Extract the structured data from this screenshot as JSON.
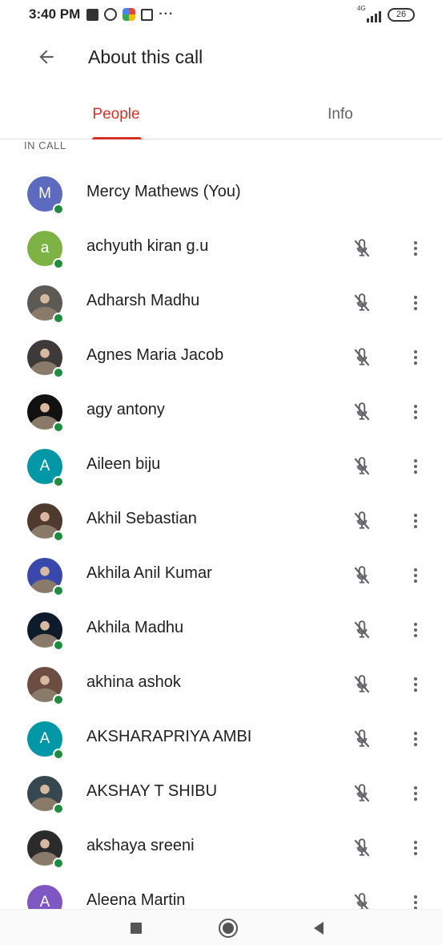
{
  "status_bar": {
    "time": "3:40 PM",
    "network": "4G",
    "battery": "26",
    "overflow": "···"
  },
  "header": {
    "title": "About this call",
    "back_icon": "arrow-back-icon"
  },
  "tabs": [
    {
      "label": "People",
      "active": true
    },
    {
      "label": "Info",
      "active": false
    }
  ],
  "section": {
    "label": "IN CALL"
  },
  "colors": {
    "accent": "#d93025",
    "presence": "#1e8e3e",
    "muted_icon": "#5f6368"
  },
  "people": [
    {
      "name": "Mercy Mathews (You)",
      "avatar_type": "letter",
      "initial": "M",
      "avatar_color": "#5c6bc0",
      "muted": false,
      "menu": false
    },
    {
      "name": "achyuth kiran g.u",
      "avatar_type": "letter",
      "initial": "a",
      "avatar_color": "#7cb342",
      "muted": true,
      "menu": true
    },
    {
      "name": "Adharsh Madhu",
      "avatar_type": "photo",
      "avatar_color": "#5d5a55",
      "muted": true,
      "menu": true
    },
    {
      "name": "Agnes Maria Jacob",
      "avatar_type": "photo",
      "avatar_color": "#3e3a3a",
      "muted": true,
      "menu": true
    },
    {
      "name": "agy antony",
      "avatar_type": "photo",
      "avatar_color": "#111111",
      "muted": true,
      "menu": true
    },
    {
      "name": "Aileen biju",
      "avatar_type": "letter",
      "initial": "A",
      "avatar_color": "#0097a7",
      "muted": true,
      "menu": true
    },
    {
      "name": "Akhil Sebastian",
      "avatar_type": "photo",
      "avatar_color": "#4e3b2e",
      "muted": true,
      "menu": true
    },
    {
      "name": "Akhila Anil Kumar",
      "avatar_type": "photo",
      "avatar_color": "#3949ab",
      "muted": true,
      "menu": true
    },
    {
      "name": "Akhila Madhu",
      "avatar_type": "photo",
      "avatar_color": "#0d1b2a",
      "muted": true,
      "menu": true
    },
    {
      "name": "akhina ashok",
      "avatar_type": "photo",
      "avatar_color": "#6d4c41",
      "muted": true,
      "menu": true
    },
    {
      "name": "AKSHARAPRIYA AMBI",
      "avatar_type": "letter",
      "initial": "A",
      "avatar_color": "#0097a7",
      "muted": true,
      "menu": true
    },
    {
      "name": "AKSHAY T SHIBU",
      "avatar_type": "photo",
      "avatar_color": "#37474f",
      "muted": true,
      "menu": true
    },
    {
      "name": "akshaya sreeni",
      "avatar_type": "photo",
      "avatar_color": "#2b2b2b",
      "muted": true,
      "menu": true
    },
    {
      "name": "Aleena Martin",
      "avatar_type": "letter",
      "initial": "A",
      "avatar_color": "#7e57c2",
      "muted": true,
      "menu": true
    }
  ],
  "icons": {
    "mute": "mic-off-icon",
    "more": "more-vert-icon",
    "presence": "online-dot-icon"
  },
  "nav_bar": {
    "recents": "square-icon",
    "home": "circle-icon",
    "back": "triangle-back-icon"
  }
}
